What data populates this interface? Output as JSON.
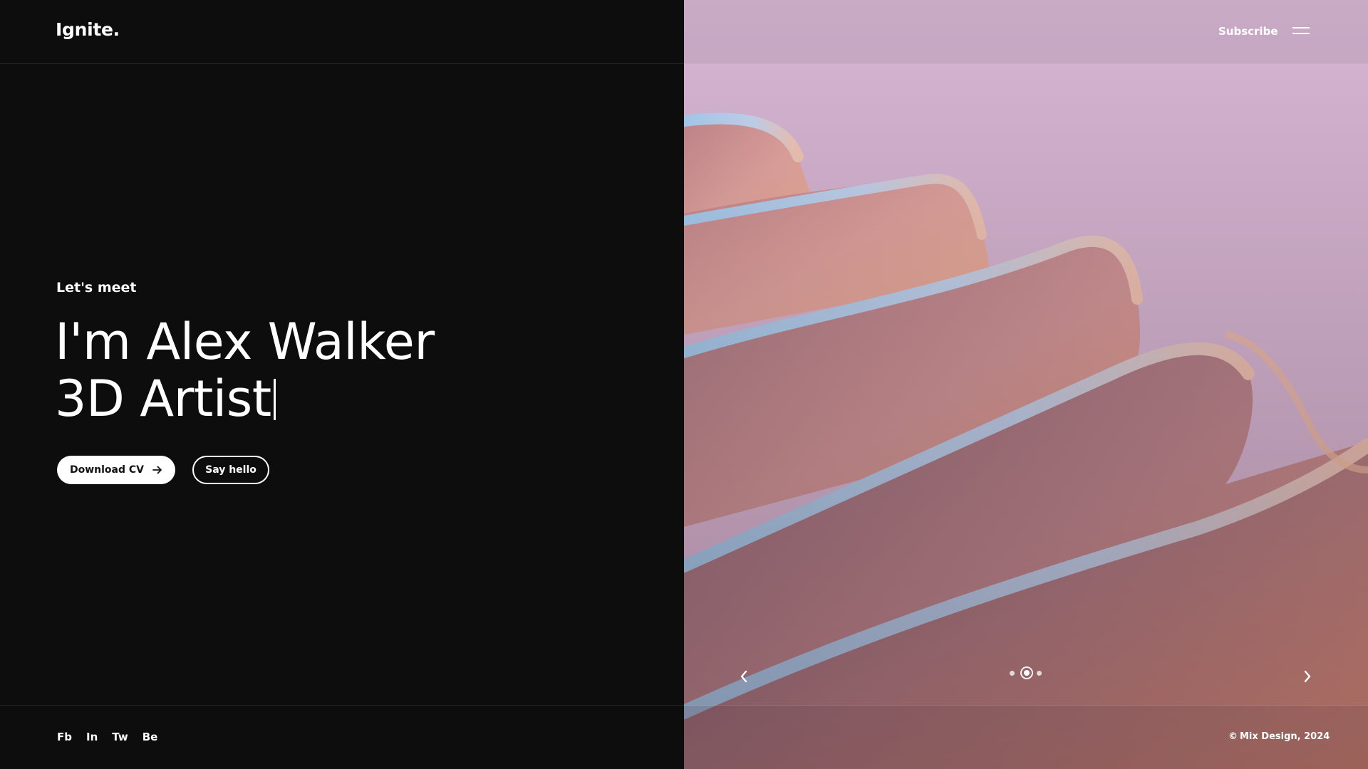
{
  "header": {
    "logo": "Ignite.",
    "subscribe_label": "Subscribe",
    "menu_icon": "hamburger-icon"
  },
  "hero": {
    "eyebrow": "Let's meet",
    "headline_line1": "I'm Alex Walker",
    "headline_line2": "3D Artist",
    "primary_button": "Download CV",
    "primary_button_icon": "arrow-right-icon",
    "secondary_button": "Say hello"
  },
  "slider": {
    "prev_icon": "chevron-left-icon",
    "next_icon": "chevron-right-icon",
    "slide_count": 3,
    "active_slide": 2
  },
  "footer": {
    "social": [
      "Fb",
      "In",
      "Tw",
      "Be"
    ],
    "copyright_symbol": "©",
    "copyright": "Mix Design, 2024"
  },
  "colors": {
    "background": "#0d0d0d",
    "text": "#ffffff",
    "image_sky": "#dbb6d4",
    "image_peach": "#f2a58e",
    "image_blue": "#9fc6ee"
  }
}
